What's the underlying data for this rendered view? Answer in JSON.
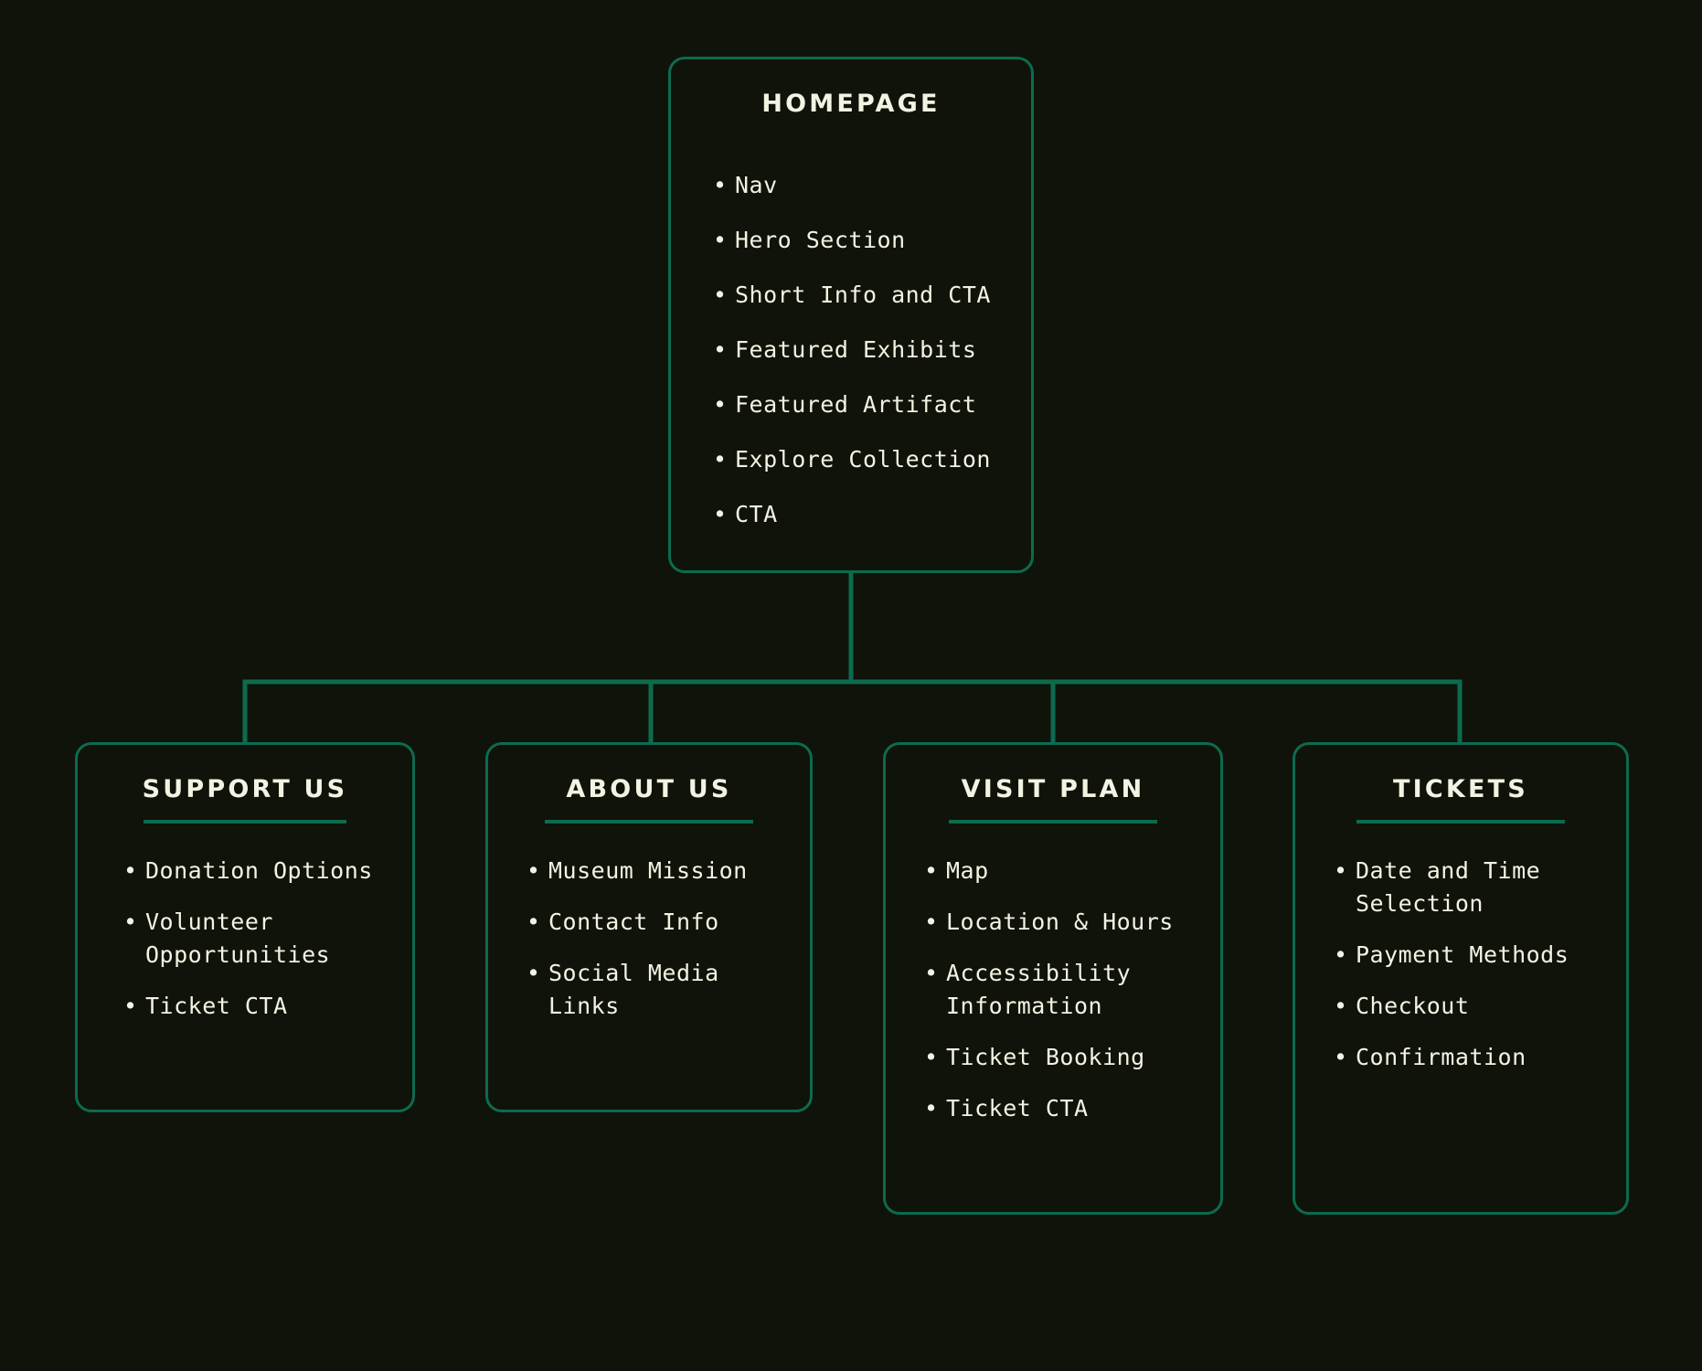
{
  "diagram": {
    "type": "sitemap",
    "theme": {
      "background": "#101309",
      "accent": "#0c6b4f",
      "text": "#f2f3e2"
    },
    "root": {
      "id": "homepage",
      "title": "HOMEPAGE",
      "items": [
        "Nav",
        "Hero Section",
        "Short Info and CTA",
        "Featured Exhibits",
        "Featured Artifact",
        "Explore Collection",
        "CTA"
      ]
    },
    "children": [
      {
        "id": "support-us",
        "title": "SUPPORT US",
        "items": [
          "Donation Options",
          "Volunteer Opportunities",
          "Ticket CTA"
        ]
      },
      {
        "id": "about-us",
        "title": "ABOUT US",
        "items": [
          "Museum Mission",
          "Contact Info",
          "Social Media Links"
        ]
      },
      {
        "id": "visit-plan",
        "title": "VISIT PLAN",
        "items": [
          "Map",
          "Location & Hours",
          "Accessibility Information",
          "Ticket Booking",
          "Ticket CTA"
        ]
      },
      {
        "id": "tickets",
        "title": "TICKETS",
        "items": [
          "Date and Time Selection",
          "Payment Methods",
          "Checkout",
          "Confirmation"
        ]
      }
    ]
  }
}
